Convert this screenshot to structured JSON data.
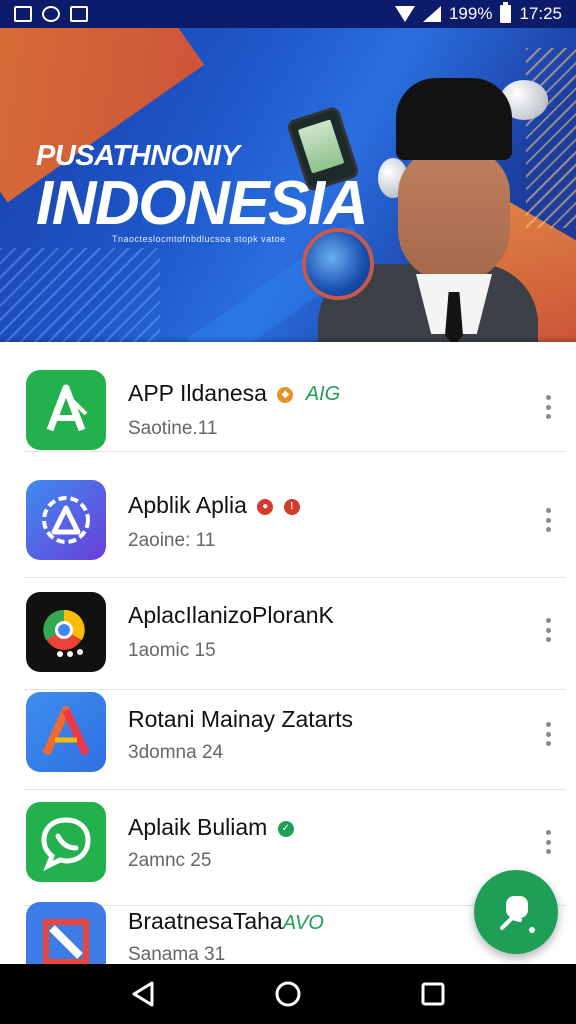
{
  "status_bar": {
    "battery_text": "199%",
    "time": "17:25",
    "left_icons": [
      "gallery-icon",
      "settings-gear-icon",
      "image-icon"
    ],
    "right_icons": [
      "wifi-icon",
      "signal-icon",
      "battery-icon"
    ]
  },
  "banner": {
    "title_line1": "PUSATHNONIY",
    "title_line2": "INDONESIA",
    "subtitle": "Tnaocteslocmtofnbdlucsoa stopk vatoe"
  },
  "apps": [
    {
      "name": "APP Ildanesa",
      "badge_text": "AIG",
      "badge_color": "#1f9e57",
      "dot_color": "#e7912a",
      "subtitle": "Saotine.11",
      "icon": "a-logo-icon",
      "icon_bg": "#22b14c"
    },
    {
      "name": "Apblik Aplia",
      "badge_text": "",
      "dot_color": "#d33a2c",
      "subtitle": "2aoine: 11",
      "icon": "triangle-gear-icon",
      "icon_bg": "#4a5fe0"
    },
    {
      "name": "AplacIlanizoPloranK",
      "badge_text": "",
      "dot_color": "",
      "subtitle": "1aomic 15",
      "icon": "chrome-icon",
      "icon_bg": "#111111"
    },
    {
      "name": "Rotani Mainay Zatarts",
      "badge_text": "",
      "dot_color": "",
      "subtitle": "3domna 24",
      "icon": "a-triangle-icon",
      "icon_bg": "#2f7de8"
    },
    {
      "name": "Aplaik Buliam",
      "badge_text": "",
      "dot_color": "#1f9e57",
      "subtitle": "2amnc 25",
      "icon": "chat-bubble-icon",
      "icon_bg": "#22b14c"
    },
    {
      "name": "BraatnesaTaha",
      "badge_text": "AVO",
      "badge_color": "#1f9e57",
      "dot_color": "",
      "subtitle": "Sanama 31",
      "icon": "n-square-icon",
      "icon_bg": "#3d7be6"
    }
  ],
  "fab": {
    "icon": "chat-person-icon",
    "color": "#1f9e57"
  },
  "nav_bar": {
    "icons": [
      "back-icon",
      "home-icon",
      "recents-icon"
    ]
  }
}
